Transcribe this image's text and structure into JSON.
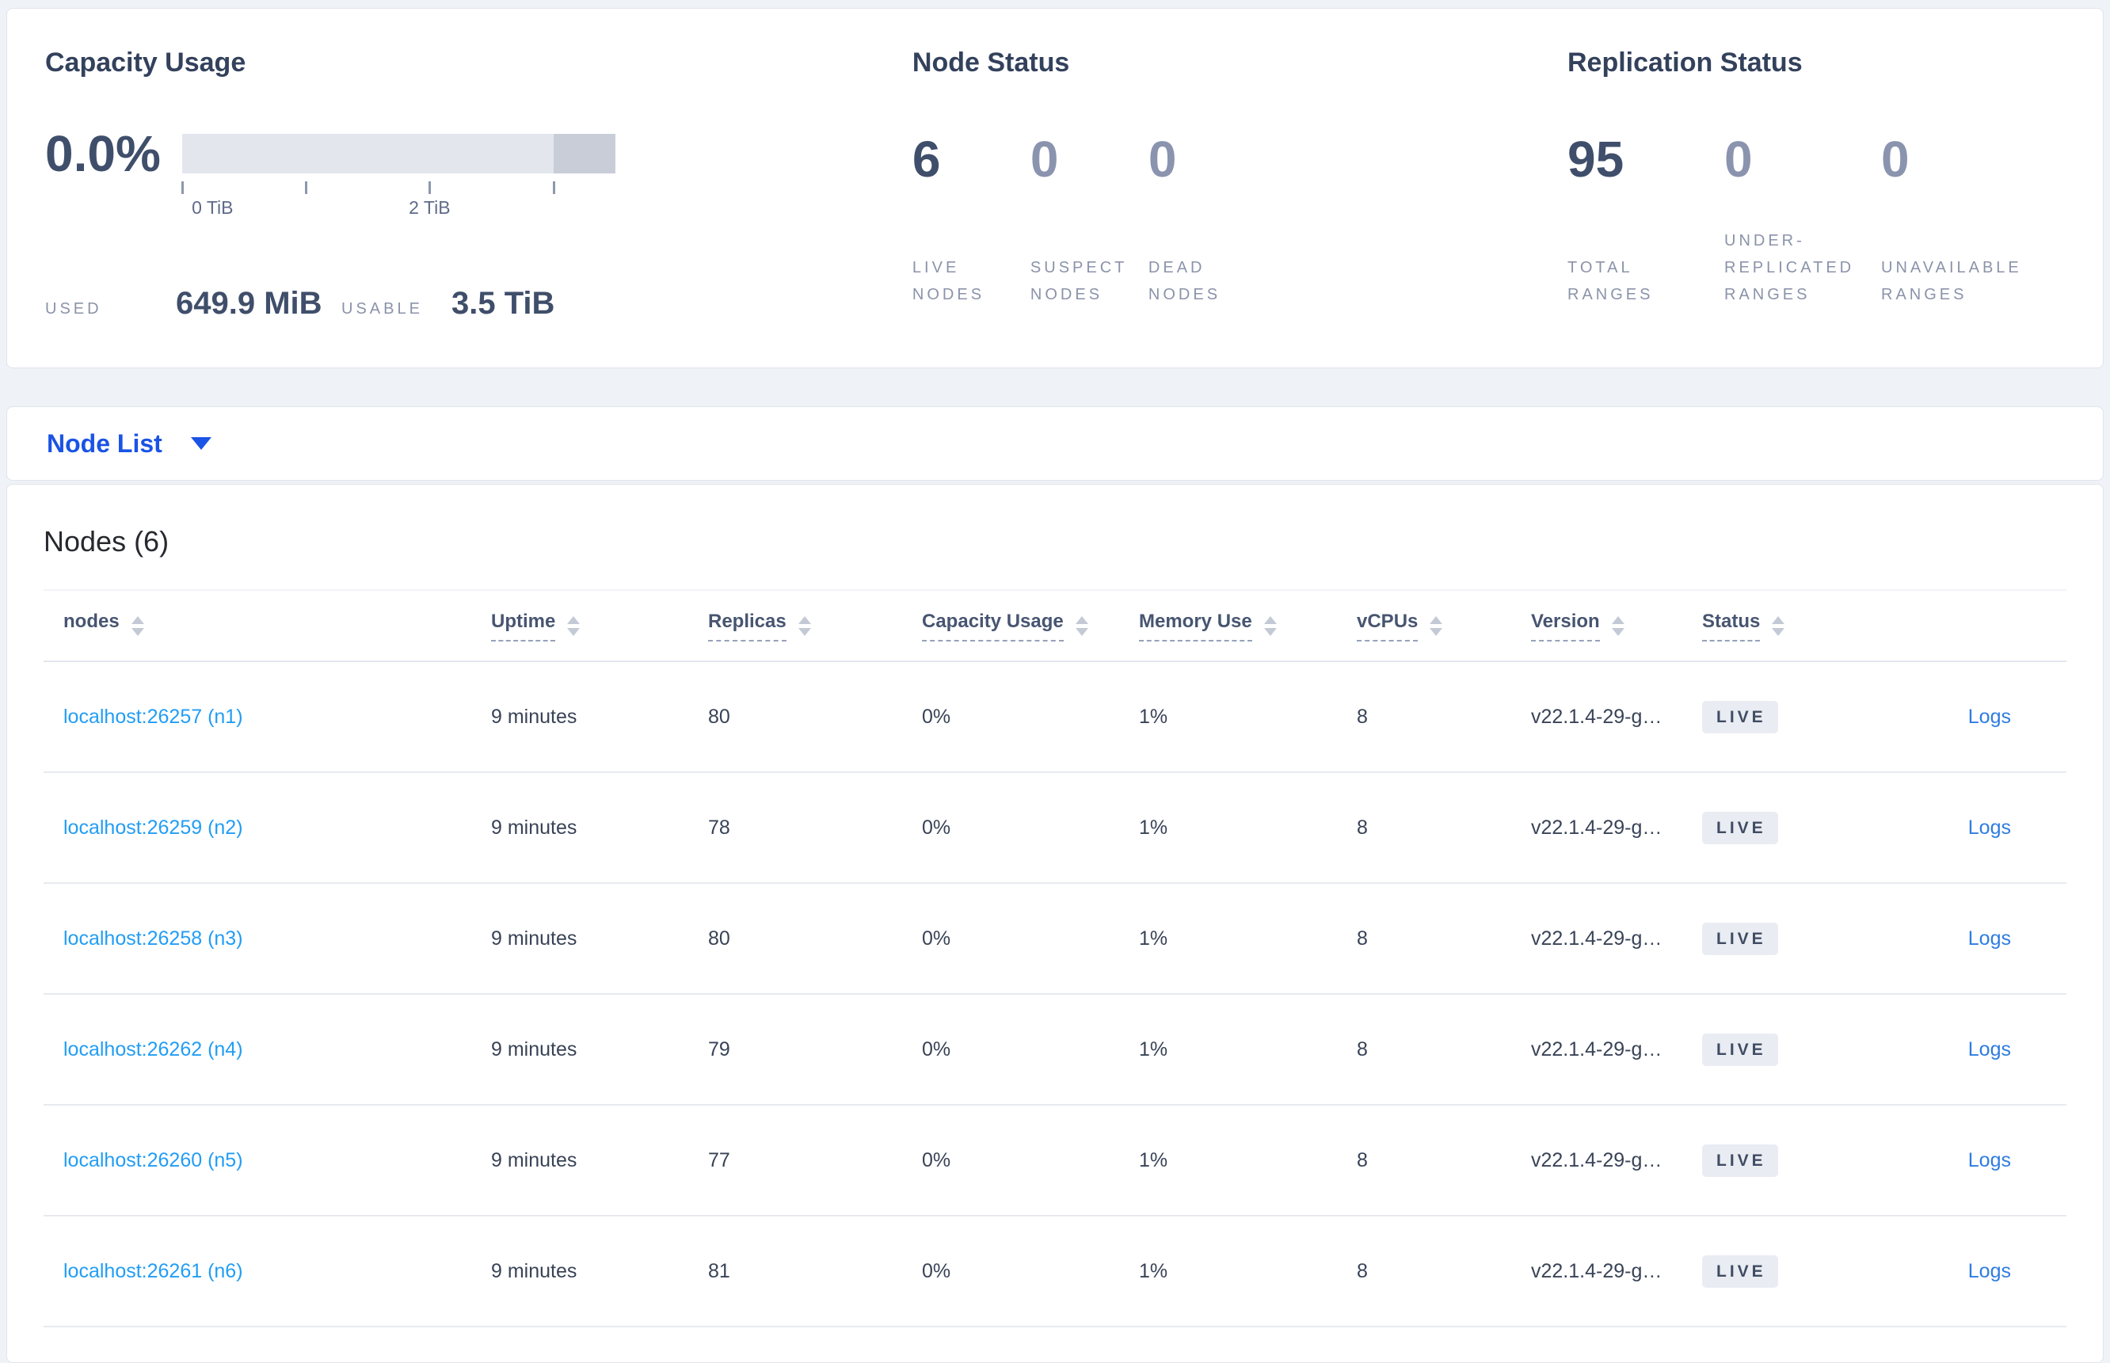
{
  "capacity": {
    "title": "Capacity Usage",
    "percent": "0.0%",
    "used_label": "USED",
    "used_value": "649.9 MiB",
    "usable_label": "USABLE",
    "usable_value": "3.5 TiB",
    "axis_ticks": [
      {
        "pos_pct": 0,
        "label": "0 TiB"
      },
      {
        "pos_pct": 28.6,
        "label": ""
      },
      {
        "pos_pct": 57.1,
        "label": "2 TiB"
      },
      {
        "pos_pct": 85.7,
        "label": ""
      }
    ],
    "bar": {
      "track_color": "#e3e6ed",
      "segment_color": "#c9cdd8",
      "segment_start_pct": 85.7
    }
  },
  "node_status": {
    "title": "Node Status",
    "stats": [
      {
        "value": "6",
        "label": "LIVE NODES"
      },
      {
        "value": "0",
        "label": "SUSPECT NODES"
      },
      {
        "value": "0",
        "label": "DEAD NODES"
      }
    ]
  },
  "replication_status": {
    "title": "Replication Status",
    "stats": [
      {
        "value": "95",
        "label": "TOTAL RANGES"
      },
      {
        "value": "0",
        "label": "UNDER-REPLICATED RANGES"
      },
      {
        "value": "0",
        "label": "UNAVAILABLE RANGES"
      }
    ]
  },
  "view_selector": {
    "label": "Node List"
  },
  "nodes_table": {
    "title": "Nodes (6)",
    "columns": [
      {
        "label": "nodes"
      },
      {
        "label": "Uptime"
      },
      {
        "label": "Replicas"
      },
      {
        "label": "Capacity Usage"
      },
      {
        "label": "Memory Use"
      },
      {
        "label": "vCPUs"
      },
      {
        "label": "Version"
      },
      {
        "label": "Status"
      }
    ],
    "rows": [
      {
        "node": "localhost:26257 (n1)",
        "uptime": "9 minutes",
        "replicas": "80",
        "capacity_usage": "0%",
        "memory_use": "1%",
        "vcpus": "8",
        "version": "v22.1.4-29-g…",
        "status": "LIVE",
        "logs": "Logs"
      },
      {
        "node": "localhost:26259 (n2)",
        "uptime": "9 minutes",
        "replicas": "78",
        "capacity_usage": "0%",
        "memory_use": "1%",
        "vcpus": "8",
        "version": "v22.1.4-29-g…",
        "status": "LIVE",
        "logs": "Logs"
      },
      {
        "node": "localhost:26258 (n3)",
        "uptime": "9 minutes",
        "replicas": "80",
        "capacity_usage": "0%",
        "memory_use": "1%",
        "vcpus": "8",
        "version": "v22.1.4-29-g…",
        "status": "LIVE",
        "logs": "Logs"
      },
      {
        "node": "localhost:26262 (n4)",
        "uptime": "9 minutes",
        "replicas": "79",
        "capacity_usage": "0%",
        "memory_use": "1%",
        "vcpus": "8",
        "version": "v22.1.4-29-g…",
        "status": "LIVE",
        "logs": "Logs"
      },
      {
        "node": "localhost:26260 (n5)",
        "uptime": "9 minutes",
        "replicas": "77",
        "capacity_usage": "0%",
        "memory_use": "1%",
        "vcpus": "8",
        "version": "v22.1.4-29-g…",
        "status": "LIVE",
        "logs": "Logs"
      },
      {
        "node": "localhost:26261 (n6)",
        "uptime": "9 minutes",
        "replicas": "81",
        "capacity_usage": "0%",
        "memory_use": "1%",
        "vcpus": "8",
        "version": "v22.1.4-29-g…",
        "status": "LIVE",
        "logs": "Logs"
      }
    ]
  },
  "colors": {
    "page_background": "#eff2f6",
    "selector_blue": "#1a53e5",
    "node_link_blue": "#229df4",
    "logs_link_blue": "#2e7ce0",
    "badge_background": "#e9ecf2",
    "badge_text": "#3f4c63"
  }
}
